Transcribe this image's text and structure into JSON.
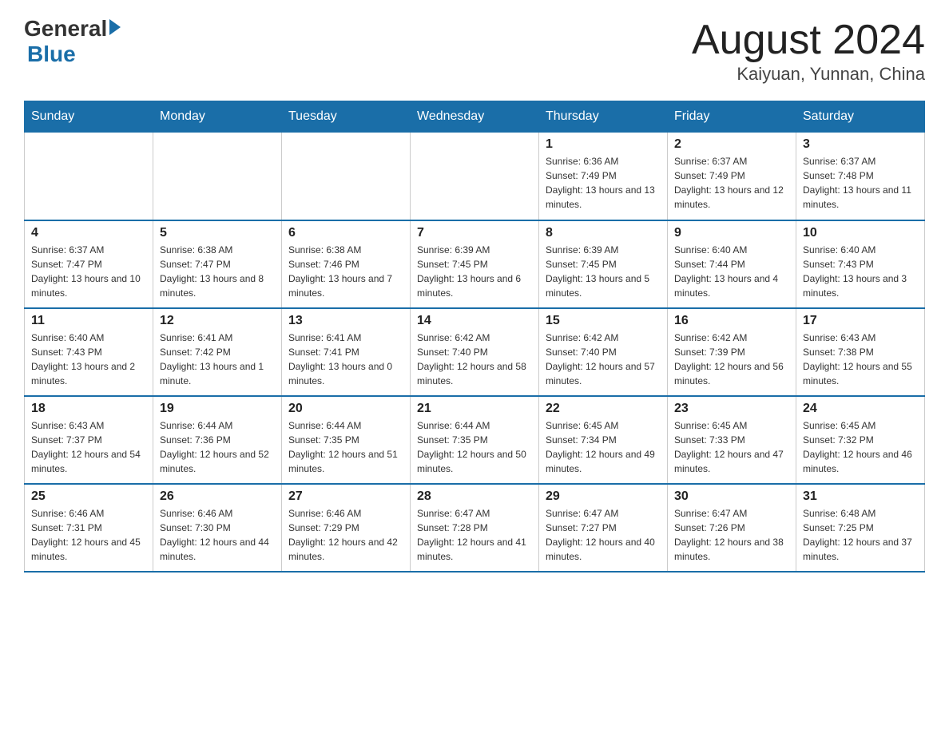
{
  "header": {
    "logo_general": "General",
    "logo_blue": "Blue",
    "month_title": "August 2024",
    "location": "Kaiyuan, Yunnan, China"
  },
  "weekdays": [
    "Sunday",
    "Monday",
    "Tuesday",
    "Wednesday",
    "Thursday",
    "Friday",
    "Saturday"
  ],
  "weeks": [
    [
      {
        "day": "",
        "info": ""
      },
      {
        "day": "",
        "info": ""
      },
      {
        "day": "",
        "info": ""
      },
      {
        "day": "",
        "info": ""
      },
      {
        "day": "1",
        "info": "Sunrise: 6:36 AM\nSunset: 7:49 PM\nDaylight: 13 hours and 13 minutes."
      },
      {
        "day": "2",
        "info": "Sunrise: 6:37 AM\nSunset: 7:49 PM\nDaylight: 13 hours and 12 minutes."
      },
      {
        "day": "3",
        "info": "Sunrise: 6:37 AM\nSunset: 7:48 PM\nDaylight: 13 hours and 11 minutes."
      }
    ],
    [
      {
        "day": "4",
        "info": "Sunrise: 6:37 AM\nSunset: 7:47 PM\nDaylight: 13 hours and 10 minutes."
      },
      {
        "day": "5",
        "info": "Sunrise: 6:38 AM\nSunset: 7:47 PM\nDaylight: 13 hours and 8 minutes."
      },
      {
        "day": "6",
        "info": "Sunrise: 6:38 AM\nSunset: 7:46 PM\nDaylight: 13 hours and 7 minutes."
      },
      {
        "day": "7",
        "info": "Sunrise: 6:39 AM\nSunset: 7:45 PM\nDaylight: 13 hours and 6 minutes."
      },
      {
        "day": "8",
        "info": "Sunrise: 6:39 AM\nSunset: 7:45 PM\nDaylight: 13 hours and 5 minutes."
      },
      {
        "day": "9",
        "info": "Sunrise: 6:40 AM\nSunset: 7:44 PM\nDaylight: 13 hours and 4 minutes."
      },
      {
        "day": "10",
        "info": "Sunrise: 6:40 AM\nSunset: 7:43 PM\nDaylight: 13 hours and 3 minutes."
      }
    ],
    [
      {
        "day": "11",
        "info": "Sunrise: 6:40 AM\nSunset: 7:43 PM\nDaylight: 13 hours and 2 minutes."
      },
      {
        "day": "12",
        "info": "Sunrise: 6:41 AM\nSunset: 7:42 PM\nDaylight: 13 hours and 1 minute."
      },
      {
        "day": "13",
        "info": "Sunrise: 6:41 AM\nSunset: 7:41 PM\nDaylight: 13 hours and 0 minutes."
      },
      {
        "day": "14",
        "info": "Sunrise: 6:42 AM\nSunset: 7:40 PM\nDaylight: 12 hours and 58 minutes."
      },
      {
        "day": "15",
        "info": "Sunrise: 6:42 AM\nSunset: 7:40 PM\nDaylight: 12 hours and 57 minutes."
      },
      {
        "day": "16",
        "info": "Sunrise: 6:42 AM\nSunset: 7:39 PM\nDaylight: 12 hours and 56 minutes."
      },
      {
        "day": "17",
        "info": "Sunrise: 6:43 AM\nSunset: 7:38 PM\nDaylight: 12 hours and 55 minutes."
      }
    ],
    [
      {
        "day": "18",
        "info": "Sunrise: 6:43 AM\nSunset: 7:37 PM\nDaylight: 12 hours and 54 minutes."
      },
      {
        "day": "19",
        "info": "Sunrise: 6:44 AM\nSunset: 7:36 PM\nDaylight: 12 hours and 52 minutes."
      },
      {
        "day": "20",
        "info": "Sunrise: 6:44 AM\nSunset: 7:35 PM\nDaylight: 12 hours and 51 minutes."
      },
      {
        "day": "21",
        "info": "Sunrise: 6:44 AM\nSunset: 7:35 PM\nDaylight: 12 hours and 50 minutes."
      },
      {
        "day": "22",
        "info": "Sunrise: 6:45 AM\nSunset: 7:34 PM\nDaylight: 12 hours and 49 minutes."
      },
      {
        "day": "23",
        "info": "Sunrise: 6:45 AM\nSunset: 7:33 PM\nDaylight: 12 hours and 47 minutes."
      },
      {
        "day": "24",
        "info": "Sunrise: 6:45 AM\nSunset: 7:32 PM\nDaylight: 12 hours and 46 minutes."
      }
    ],
    [
      {
        "day": "25",
        "info": "Sunrise: 6:46 AM\nSunset: 7:31 PM\nDaylight: 12 hours and 45 minutes."
      },
      {
        "day": "26",
        "info": "Sunrise: 6:46 AM\nSunset: 7:30 PM\nDaylight: 12 hours and 44 minutes."
      },
      {
        "day": "27",
        "info": "Sunrise: 6:46 AM\nSunset: 7:29 PM\nDaylight: 12 hours and 42 minutes."
      },
      {
        "day": "28",
        "info": "Sunrise: 6:47 AM\nSunset: 7:28 PM\nDaylight: 12 hours and 41 minutes."
      },
      {
        "day": "29",
        "info": "Sunrise: 6:47 AM\nSunset: 7:27 PM\nDaylight: 12 hours and 40 minutes."
      },
      {
        "day": "30",
        "info": "Sunrise: 6:47 AM\nSunset: 7:26 PM\nDaylight: 12 hours and 38 minutes."
      },
      {
        "day": "31",
        "info": "Sunrise: 6:48 AM\nSunset: 7:25 PM\nDaylight: 12 hours and 37 minutes."
      }
    ]
  ]
}
